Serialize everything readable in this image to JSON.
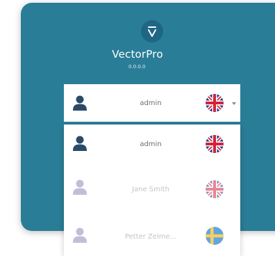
{
  "app": {
    "name": "VectorPro",
    "version": "0.0.0.0"
  },
  "selected_user": {
    "name": "admin",
    "language_icon": "uk-flag-icon"
  },
  "user_list": [
    {
      "name": "admin",
      "muted": false,
      "language_icon": "uk-flag-icon"
    },
    {
      "name": "Jane Smith",
      "muted": true,
      "language_icon": "uk-flag-icon"
    },
    {
      "name": "Petter Zelme...",
      "muted": true,
      "language_icon": "sweden-flag-icon"
    }
  ],
  "colors": {
    "card_background": "#2a7d97",
    "avatar_active": "#2b4a68",
    "avatar_muted": "#c2bdd8"
  }
}
